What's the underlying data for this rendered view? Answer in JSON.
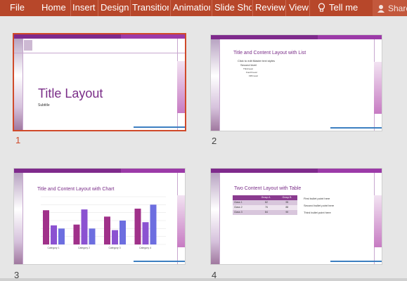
{
  "ribbon": {
    "tabs": [
      "File",
      "Home",
      "Insert",
      "Design",
      "Transitions",
      "Animations",
      "Slide Show",
      "Review",
      "View"
    ],
    "tell_me": "Tell me",
    "share": "Share"
  },
  "slides": [
    {
      "number": "1",
      "title": "Title Layout",
      "subtitle": "Subtitle"
    },
    {
      "number": "2",
      "title": "Title and Content Layout with List",
      "bullets": [
        "Click to edit Master text styles",
        "Second level",
        "Third level",
        "Fourth level",
        "Fifth level"
      ]
    },
    {
      "number": "3",
      "title": "Title and Content Layout with Chart"
    },
    {
      "number": "4",
      "title": "Two Content Layout with Table",
      "table_headers": [
        "Group A",
        "Group B"
      ],
      "table_rows": [
        [
          "Class 1",
          "82",
          "95"
        ],
        [
          "Class 2",
          "76",
          "88"
        ],
        [
          "Class 3",
          "84",
          "90"
        ]
      ],
      "bullets": [
        "First bullet point here",
        "Second bullet point here",
        "Third bullet point here"
      ]
    }
  ],
  "chart_data": {
    "type": "bar",
    "categories": [
      "Category 1",
      "Category 2",
      "Category 3",
      "Category 4"
    ],
    "series": [
      {
        "values": [
          4.3,
          2.5,
          3.5,
          4.5
        ]
      },
      {
        "values": [
          2.4,
          4.4,
          1.8,
          2.8
        ]
      },
      {
        "values": [
          2.0,
          2.0,
          3.0,
          5.0
        ]
      }
    ],
    "ylim": [
      0,
      6
    ],
    "colors": [
      "#a0318a",
      "#8b52d1",
      "#6d6ee0"
    ]
  },
  "colors": {
    "accent": "#b7472a",
    "theme_purple": "#7a2d88"
  }
}
